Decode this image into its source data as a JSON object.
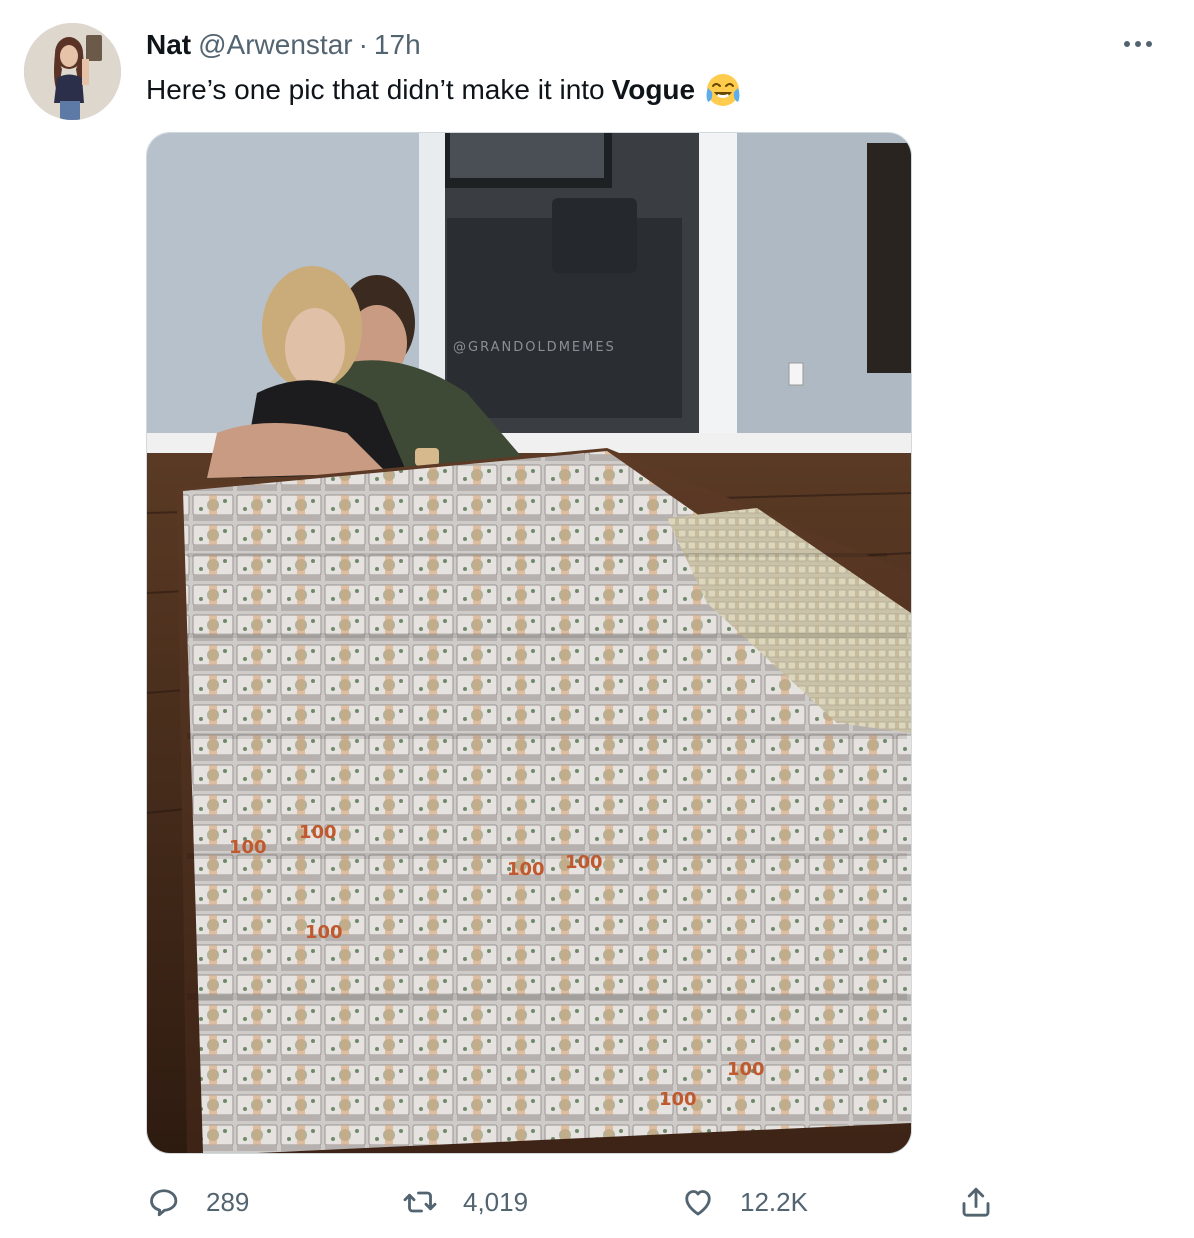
{
  "tweet": {
    "author_name": "Nat",
    "author_handle": "@Arwenstar",
    "separator": "·",
    "timestamp": "17h",
    "text_before": "Here’s one pic that didn’t make it into",
    "text_bold": "Vogue",
    "emoji": "face-with-tears-of-joy",
    "image_watermark": "@GRANDOLDMEMES"
  },
  "actions": {
    "reply_count": "289",
    "retweet_count": "4,019",
    "like_count": "12.2K"
  },
  "icons": {
    "more": "more-horizontal-icon",
    "reply": "reply-icon",
    "retweet": "retweet-icon",
    "like": "heart-icon",
    "share": "share-icon"
  },
  "colors": {
    "text": "#0f1419",
    "secondary": "#536471",
    "border": "#cfd9de"
  }
}
